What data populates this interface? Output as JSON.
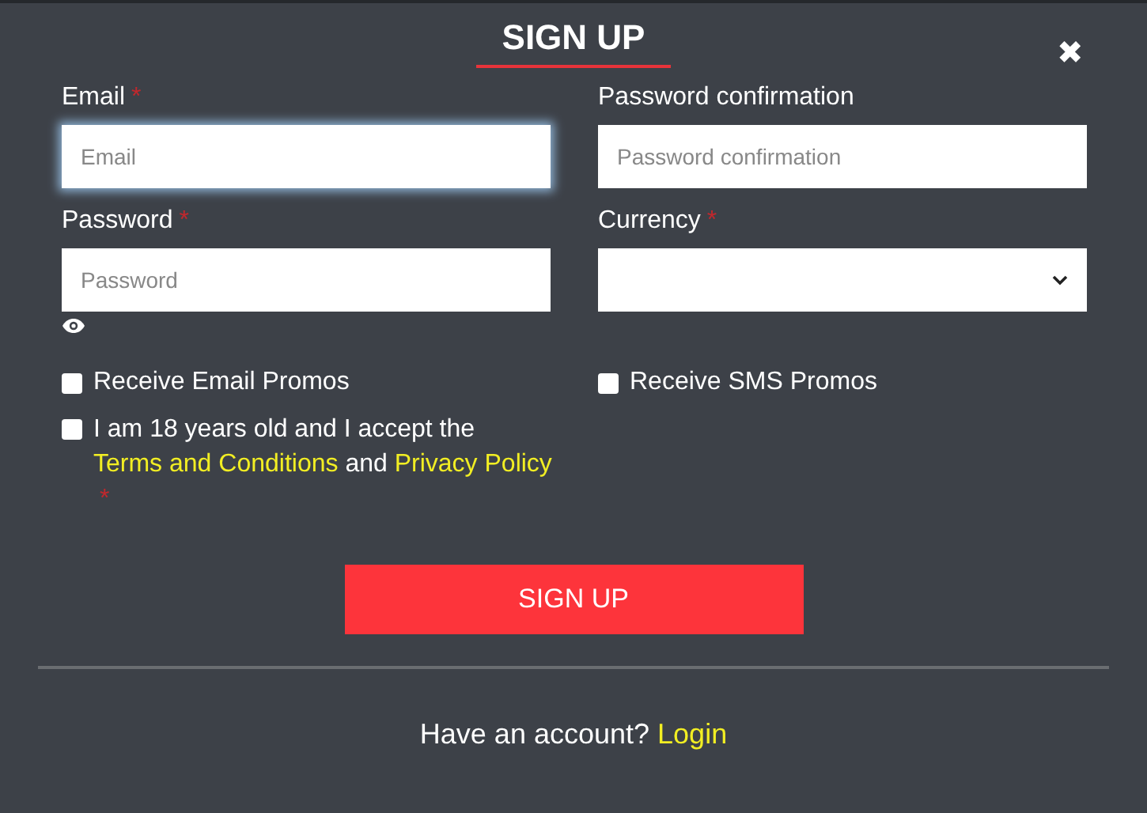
{
  "dialog": {
    "title": "SIGN UP",
    "close_icon": "✖"
  },
  "fields": [
    {
      "label": "Email",
      "required_mark": "*",
      "placeholder": "Email",
      "kind": "input",
      "focused": true
    },
    {
      "label": "Password confirmation",
      "placeholder": "Password confirmation",
      "kind": "input",
      "focused": false
    },
    {
      "label": "Password",
      "required_mark": "*",
      "placeholder": "Password",
      "kind": "password",
      "focused": false
    },
    {
      "label": "Currency",
      "required_mark": "*",
      "kind": "select",
      "focused": false
    }
  ],
  "checkboxes": [
    {
      "label": "Receive Email Promos",
      "checked": false
    },
    {
      "label": "Receive SMS Promos",
      "checked": false
    }
  ],
  "terms": {
    "checked": false,
    "text_before": "I am 18 years old and I accept the",
    "link_1": "Terms and Conditions",
    "text_middle": "and",
    "link_2": "Privacy Policy",
    "required_mark": "*"
  },
  "submit_button": "SIGN UP",
  "footer": {
    "text": "Have an account?",
    "link": "Login"
  }
}
